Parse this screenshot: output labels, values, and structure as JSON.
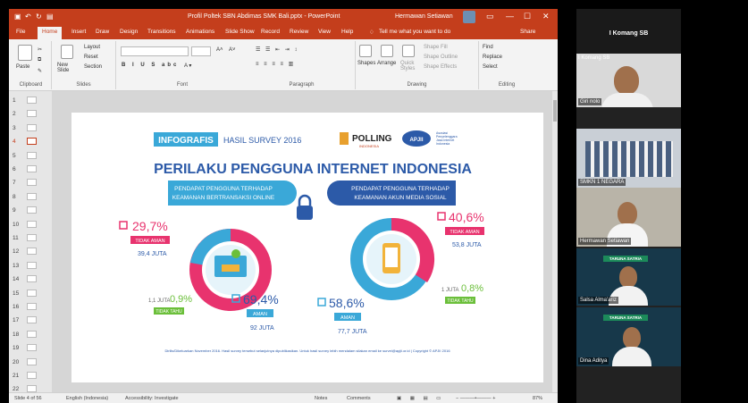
{
  "window": {
    "title": "Profil Poltek SBN Abdimas SMK Bali.pptx - PowerPoint",
    "user": "Hermawan Setiawan",
    "tell_me": "Tell me what you want to do",
    "share": "Share"
  },
  "tabs": [
    "File",
    "Home",
    "Insert",
    "Draw",
    "Design",
    "Transitions",
    "Animations",
    "Slide Show",
    "Record",
    "Review",
    "View",
    "Help"
  ],
  "ribbon": {
    "clipboard": {
      "paste": "Paste",
      "label": "Clipboard"
    },
    "slides": {
      "new_slide": "New Slide",
      "layout": "Layout",
      "reset": "Reset",
      "section": "Section",
      "label": "Slides"
    },
    "font": {
      "label": "Font"
    },
    "paragraph": {
      "label": "Paragraph"
    },
    "drawing": {
      "shapes": "Shapes",
      "arrange": "Arrange",
      "quick_styles": "Quick Styles",
      "shape_fill": "Shape Fill",
      "shape_outline": "Shape Outline",
      "shape_effects": "Shape Effects",
      "label": "Drawing"
    },
    "editing": {
      "find": "Find",
      "replace": "Replace",
      "select": "Select",
      "label": "Editing"
    }
  },
  "thumbnails": [
    "1",
    "2",
    "3",
    "4",
    "5",
    "6",
    "7",
    "8",
    "9",
    "10",
    "11",
    "12",
    "13",
    "14",
    "15",
    "16",
    "17",
    "18",
    "19",
    "20",
    "21",
    "22"
  ],
  "selected_slide": "4",
  "slide": {
    "infografis": "INFOGRAFIS",
    "hasil_survey": "HASIL SURVEY 2016",
    "polling": "POLLING",
    "polling_sub": "INDONESIA",
    "apjii": "APJII",
    "apjii_desc": "Asosiasi Penyelenggara Jasa Internet Indonesia",
    "main_title": "PERILAKU PENGGUNA INTERNET INDONESIA",
    "left_heading": "PENDAPAT PENGGUNA TERHADAP KEAMANAN BERTRANSAKSI ONLINE",
    "right_heading": "PENDAPAT PENGGUNA TERHADAP KEAMANAN AKUN MEDIA SOSIAL",
    "left": {
      "tidak_aman_pct": "29,7%",
      "tidak_aman_label": "TIDAK AMAN",
      "tidak_aman_count": "39,4 JUTA",
      "tidak_tahu_count": "1,1 JUTA",
      "tidak_tahu_pct": "0,9%",
      "tidak_tahu_label": "TIDAK TAHU",
      "aman_pct": "69,4%",
      "aman_label": "AMAN",
      "aman_count": "92 JUTA"
    },
    "right": {
      "tidak_aman_pct": "40,6%",
      "tidak_aman_label": "TIDAK AMAN",
      "tidak_aman_count": "53,8 JUTA",
      "tidak_tahu_count": "1 JUTA",
      "tidak_tahu_pct": "0,8%",
      "tidak_tahu_label": "TIDAK TAHU",
      "aman_pct": "58,6%",
      "aman_label": "AMAN",
      "aman_count": "77,7 JUTA"
    },
    "footer": "Dirilis/Dikeluarkan November 2016. Hasil survey tersebut selanjutnya dipublikasikan. Untuk hasil survey lebih mendalam silakan email ke survei@apjii.or.id | Copyright © APJII 2016"
  },
  "status": {
    "slide_of": "Slide 4 of 56",
    "language": "English (Indonesia)",
    "accessibility": "Accessibility: Investigate",
    "notes": "Notes",
    "comments": "Comments",
    "zoom": "87%"
  },
  "meeting": {
    "host": "I Komang SB",
    "participants": [
      "I Komang SB",
      "Giri nolo",
      "SMKN 1 NEGARA",
      "Hermawan Setiawan",
      "Salsa Alma'ariz",
      "Dina Aditya"
    ],
    "badge": "TARUNA SATRIA"
  },
  "colors": {
    "ppt_red": "#c43e1c",
    "slide_blue": "#2c5aa8",
    "pink": "#e8336e",
    "cyan": "#3aa8d8",
    "green": "#6bbf3a"
  }
}
